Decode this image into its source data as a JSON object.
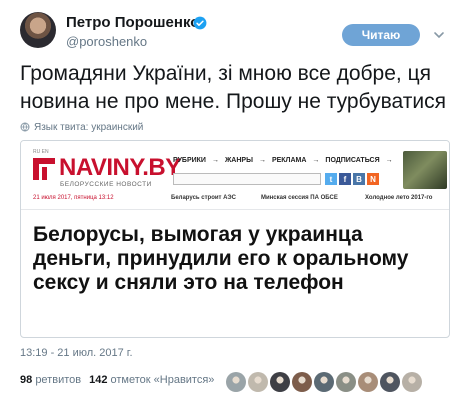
{
  "tweet": {
    "author_name": "Петро Порошенко",
    "author_handle": "@poroshenko",
    "follow_label": "Читаю",
    "text": "Громадяни України, зі мною все добре, ця новина не про мене. Прошу не турбуватися",
    "language_note": "Язык твита: украинский",
    "timestamp": "13:19 - 21 июл. 2017 г.",
    "retweets_count": "98",
    "retweets_label": "ретвитов",
    "likes_count": "142",
    "likes_label": "отметок «Нравится»"
  },
  "card": {
    "lang_switch": "RU EN",
    "logo_text": "NAVINY.BY",
    "logo_subtitle": "БЕЛОРУССКИЕ НОВОСТИ",
    "nav": [
      "РУБРИКИ",
      "ЖАНРЫ",
      "РЕКЛАМА",
      "ПОДПИСАТЬСЯ"
    ],
    "nav_arrow": "→",
    "social": [
      {
        "icon": "twitter-icon",
        "glyph": "t",
        "color": "#55acee"
      },
      {
        "icon": "facebook-icon",
        "glyph": "f",
        "color": "#3b5998"
      },
      {
        "icon": "vk-icon",
        "glyph": "B",
        "color": "#4a76a8"
      },
      {
        "icon": "rss-icon",
        "glyph": "N",
        "color": "#f26522"
      }
    ],
    "date_line": "21 июля 2017, пятница 13:12",
    "top_headlines": [
      "Беларусь строит АЭС",
      "Минская сессия ПА ОБСЕ",
      "Холодное лето 2017-го"
    ],
    "headline": "Белорусы, вымогая у украинца деньги, принудили его к оральному сексу и сняли это на телефон",
    "brand_color": "#c8102e"
  },
  "colors": {
    "follow_button": "#6fa4d6",
    "meta_text": "#657786"
  },
  "likers": [
    {
      "icon": "avatar-icon",
      "color": "#9aa4a8"
    },
    {
      "icon": "avatar-icon",
      "color": "#c0b9ad"
    },
    {
      "icon": "avatar-icon",
      "color": "#3e3f45"
    },
    {
      "icon": "avatar-icon",
      "color": "#7d5d4b"
    },
    {
      "icon": "avatar-icon",
      "color": "#5b6a74"
    },
    {
      "icon": "avatar-icon",
      "color": "#8a8f86"
    },
    {
      "icon": "avatar-icon",
      "color": "#a88d78"
    },
    {
      "icon": "avatar-icon",
      "color": "#4f5560"
    },
    {
      "icon": "avatar-icon",
      "color": "#b7b0a6"
    }
  ]
}
